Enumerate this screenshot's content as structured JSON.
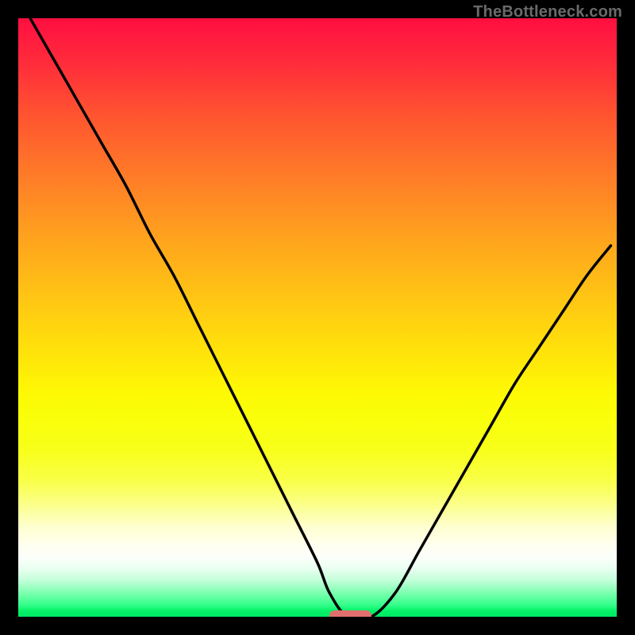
{
  "attribution": "TheBottleneck.com",
  "colors": {
    "frame": "#000000",
    "gradient_top": "#ff0f3f",
    "gradient_mid": "#ffe30a",
    "gradient_bottom": "#00e763",
    "curve": "#000000",
    "marker": "#e26f6f"
  },
  "chart_data": {
    "type": "line",
    "title": "",
    "xlabel": "",
    "ylabel": "",
    "xlim": [
      0,
      100
    ],
    "ylim": [
      0,
      100
    ],
    "series": [
      {
        "name": "curve",
        "x": [
          2,
          6,
          10,
          14,
          18,
          22,
          26,
          30,
          34,
          38,
          42,
          46,
          50,
          52,
          55,
          59,
          63,
          67,
          71,
          75,
          79,
          83,
          87,
          91,
          95,
          99
        ],
        "y": [
          100,
          93,
          86,
          79,
          72,
          64,
          57,
          49,
          41,
          33,
          25,
          17,
          9,
          4,
          0,
          0,
          4,
          11,
          18,
          25,
          32,
          39,
          45,
          51,
          57,
          62
        ]
      }
    ],
    "markers": [
      {
        "name": "bottleneck-point",
        "x_start": 52,
        "x_end": 59,
        "y": 0
      }
    ],
    "legend": false,
    "grid": false
  }
}
